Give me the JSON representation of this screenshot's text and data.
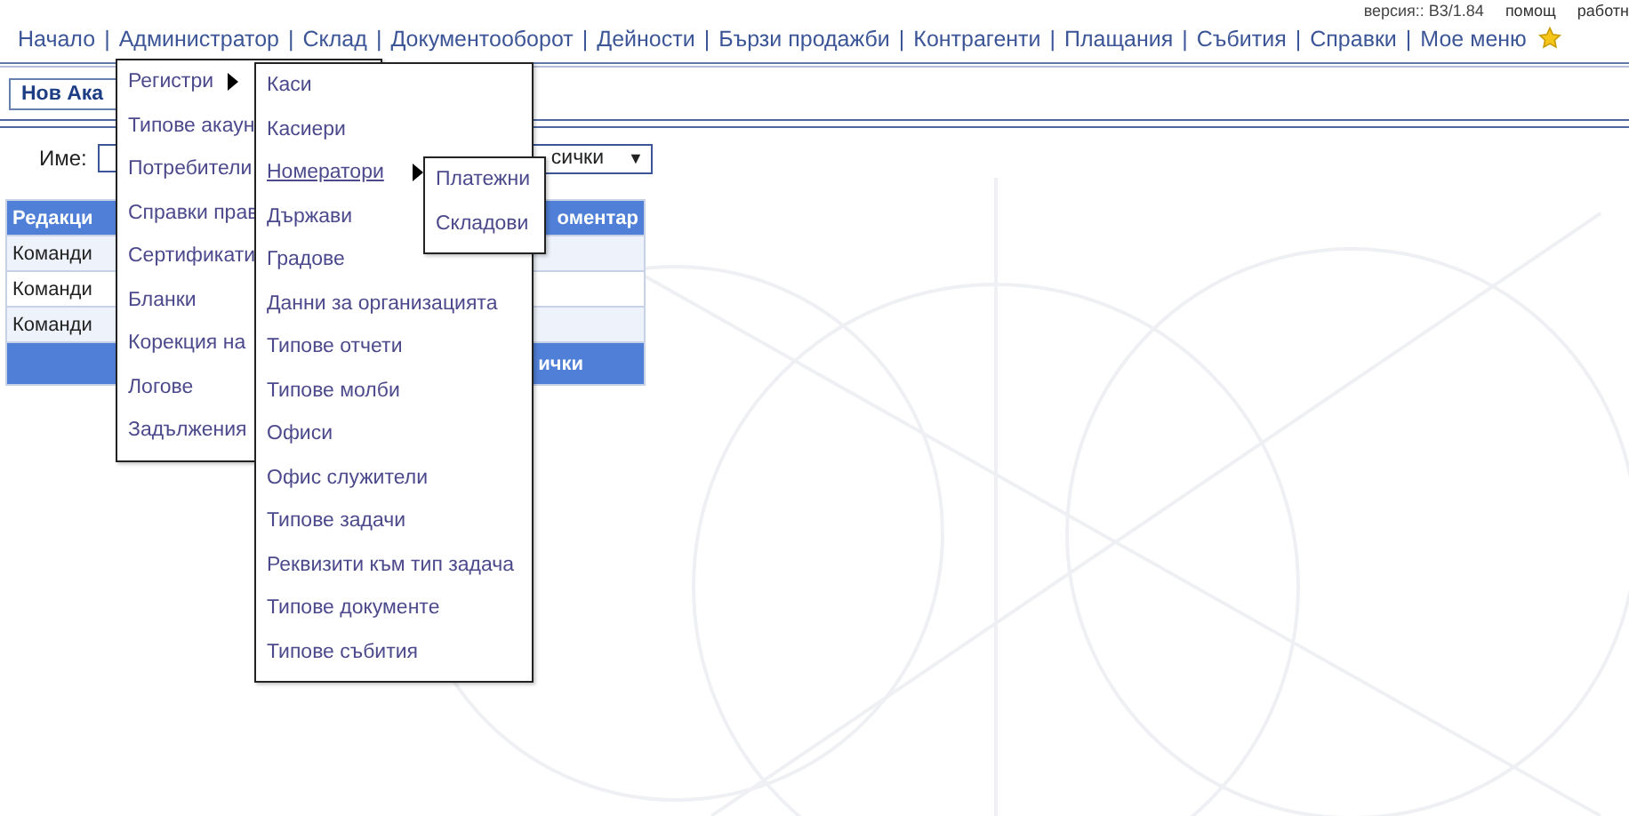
{
  "top_links": {
    "version": "версия:: B3/1.84",
    "links": [
      "помощ",
      "работн"
    ]
  },
  "nav": {
    "separator": "|",
    "items": [
      "Начало",
      "Администратор",
      "Склад",
      "Документооборот",
      "Дейности",
      "Бързи продажби",
      "Контрагенти",
      "Плащания",
      "Събития",
      "Справки",
      "Мое меню"
    ]
  },
  "page_title": "Нов Ака",
  "filter": {
    "label": "Име:",
    "select_value": "сички",
    "select_arrow": "▼"
  },
  "table": {
    "header": [
      "Редакци",
      "оментар"
    ],
    "rows": [
      "Команди",
      "Команди",
      "Команди"
    ],
    "footer": "ички"
  },
  "menus": [
    {
      "items": [
        {
          "label": "Регистри",
          "kind": "submenu",
          "selected": false
        },
        {
          "label": "Типове акаун",
          "kind": "item",
          "selected": false
        },
        {
          "label": "Потребители",
          "kind": "item",
          "selected": false
        },
        {
          "label": "Справки прав",
          "kind": "item",
          "selected": false
        },
        {
          "label": "Сертификати",
          "kind": "item",
          "selected": false
        },
        {
          "label": "Бланки",
          "kind": "item",
          "selected": false
        },
        {
          "label": "Корекция на",
          "kind": "item",
          "selected": false
        },
        {
          "label": "Логове",
          "kind": "item",
          "selected": false
        },
        {
          "label": "Задължения",
          "kind": "item",
          "selected": false
        }
      ]
    },
    {
      "items": [
        {
          "label": "Каси",
          "kind": "item",
          "selected": false
        },
        {
          "label": "Касиери",
          "kind": "item",
          "selected": false
        },
        {
          "label": "Номератори",
          "kind": "submenu",
          "selected": true
        },
        {
          "label": "Държави",
          "kind": "item",
          "selected": false
        },
        {
          "label": "Градове",
          "kind": "item",
          "selected": false
        },
        {
          "label": "Данни за организацията",
          "kind": "item",
          "selected": false
        },
        {
          "label": "Типове отчети",
          "kind": "item",
          "selected": false
        },
        {
          "label": "Типове молби",
          "kind": "item",
          "selected": false
        },
        {
          "label": "Офиси",
          "kind": "item",
          "selected": false
        },
        {
          "label": "Офис служители",
          "kind": "item",
          "selected": false
        },
        {
          "label": "Типове задачи",
          "kind": "item",
          "selected": false
        },
        {
          "label": "Реквизити към тип задача",
          "kind": "item",
          "selected": false
        },
        {
          "label": "Типове документе",
          "kind": "item",
          "selected": false
        },
        {
          "label": "Типове събития",
          "kind": "item",
          "selected": false
        }
      ]
    },
    {
      "items": [
        {
          "label": "Платежни",
          "kind": "item",
          "selected": false
        },
        {
          "label": "Складови",
          "kind": "item",
          "selected": false
        }
      ]
    }
  ]
}
